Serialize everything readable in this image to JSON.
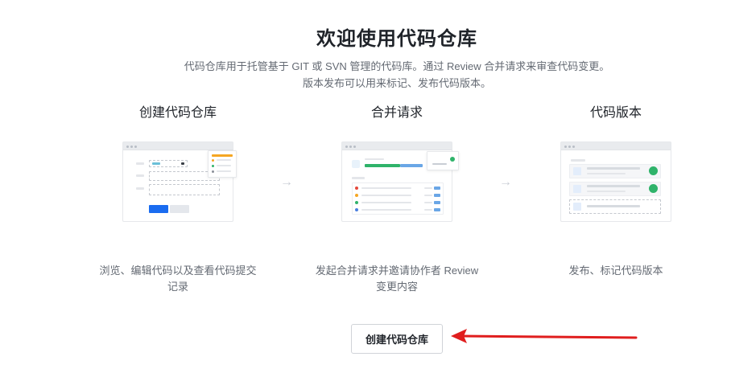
{
  "header": {
    "title": "欢迎使用代码仓库",
    "subtitle_line1": "代码仓库用于托管基于 GIT 或 SVN 管理的代码库。通过 Review 合并请求来审查代码变更。",
    "subtitle_line2": "版本发布可以用来标记、发布代码版本。"
  },
  "steps": [
    {
      "title": "创建代码仓库",
      "desc_line1": "浏览、编辑代码以及查看代码提交",
      "desc_line2": "记录"
    },
    {
      "title": "合并请求",
      "desc_line1": "发起合并请求并邀请协作者 Review",
      "desc_line2": "变更内容"
    },
    {
      "title": "代码版本",
      "desc_line1": "发布、标记代码版本",
      "desc_line2": ""
    }
  ],
  "icons": {
    "step_arrow": "→"
  },
  "cta": {
    "label": "创建代码仓库"
  },
  "colors": {
    "primary": "#1a6cf0",
    "success": "#2fb36a",
    "annotation_arrow": "#e01e1e"
  }
}
